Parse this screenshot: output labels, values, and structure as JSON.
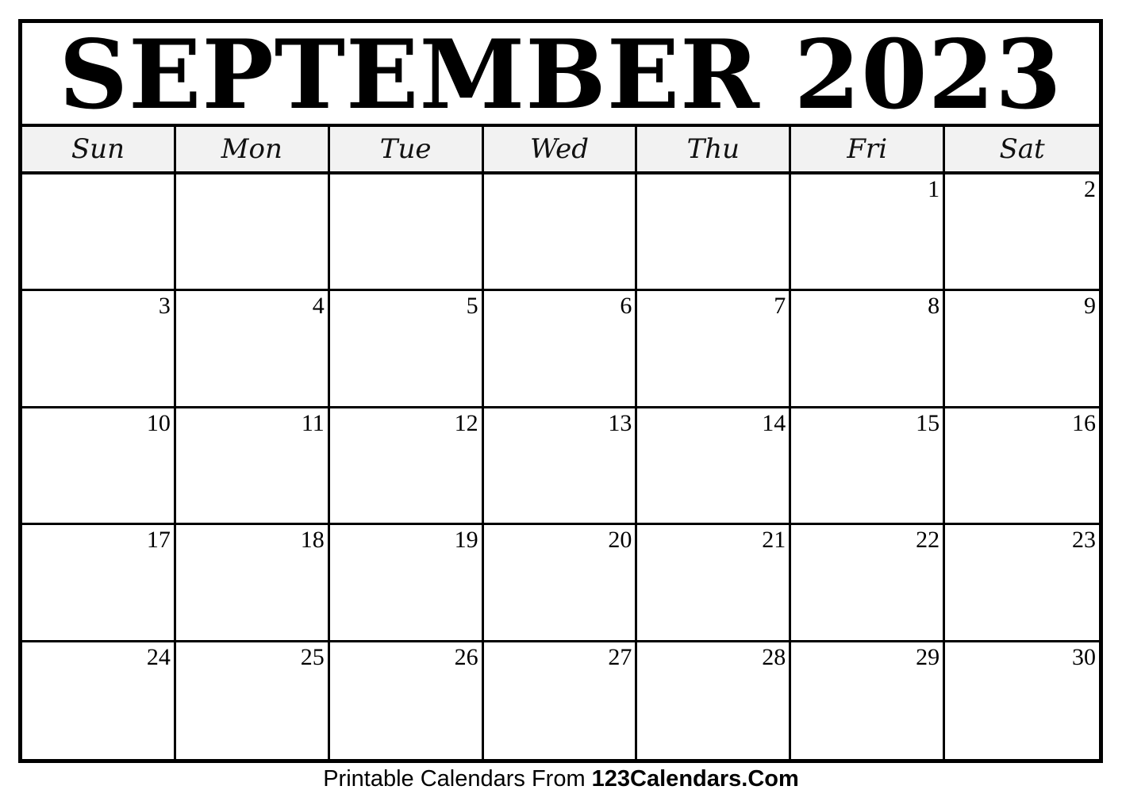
{
  "calendar": {
    "title": "SEPTEMBER 2023",
    "weekdays": [
      "Sun",
      "Mon",
      "Tue",
      "Wed",
      "Thu",
      "Fri",
      "Sat"
    ],
    "days": [
      "",
      "",
      "",
      "",
      "",
      "1",
      "2",
      "3",
      "4",
      "5",
      "6",
      "7",
      "8",
      "9",
      "10",
      "11",
      "12",
      "13",
      "14",
      "15",
      "16",
      "17",
      "18",
      "19",
      "20",
      "21",
      "22",
      "23",
      "24",
      "25",
      "26",
      "27",
      "28",
      "29",
      "30"
    ]
  },
  "footer": {
    "prefix": "Printable Calendars From ",
    "site": "123Calendars.Com"
  }
}
